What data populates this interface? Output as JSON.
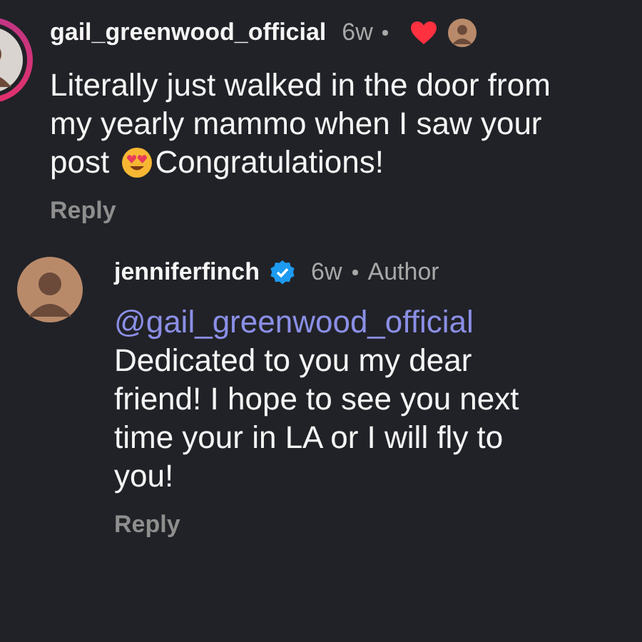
{
  "comments": [
    {
      "username": "gail_greenwood_official",
      "verified": false,
      "time": "6w",
      "liked_by_author": true,
      "text_before_emoji": "Literally just walked in the door from my yearly mammo when I saw your post",
      "text_after_emoji": "Congratulations!",
      "reply": "Reply",
      "story_ring": true,
      "indented": false
    },
    {
      "username": "jenniferfinch",
      "verified": true,
      "time": "6w",
      "author_label": "Author",
      "liked_by_author": false,
      "mention": "@gail_greenwood_official",
      "text_before_emoji": "Dedicated to you my dear friend! I hope to see you next time your in LA or I will fly to you!",
      "reply": "Reply",
      "story_ring": false,
      "indented": true
    }
  ]
}
